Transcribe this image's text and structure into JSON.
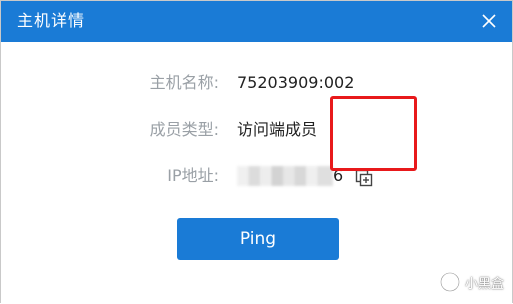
{
  "window": {
    "title": "主机详情",
    "accent_color": "#1a7bd6",
    "close_icon": "close-icon"
  },
  "details": {
    "host_label": "主机名称:",
    "host_value": "75203909:002",
    "role_label": "成员类型:",
    "role_value": "访问端成员",
    "ip_label": "IP地址:",
    "ip_visible_suffix": "6",
    "copy_icon": "copy-icon"
  },
  "actions": {
    "ping_label": "Ping"
  },
  "annotation": {
    "highlight_color": "#e8191b"
  },
  "watermark": {
    "text": "小黑盒"
  }
}
